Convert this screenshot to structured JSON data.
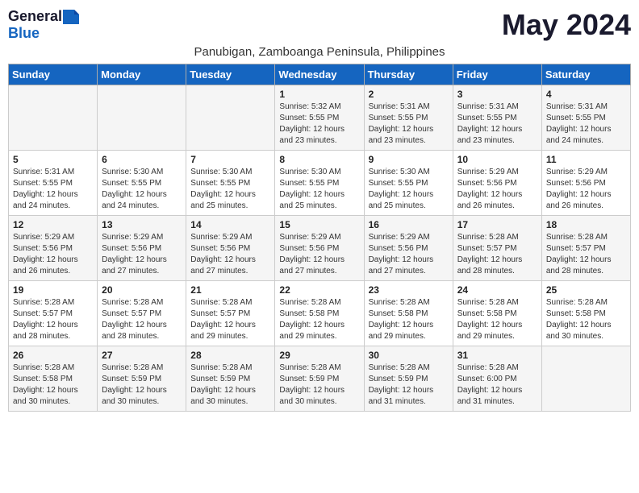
{
  "logo": {
    "general": "General",
    "blue": "Blue"
  },
  "header": {
    "month": "May 2024",
    "location": "Panubigan, Zamboanga Peninsula, Philippines"
  },
  "weekdays": [
    "Sunday",
    "Monday",
    "Tuesday",
    "Wednesday",
    "Thursday",
    "Friday",
    "Saturday"
  ],
  "weeks": [
    [
      {
        "day": "",
        "info": ""
      },
      {
        "day": "",
        "info": ""
      },
      {
        "day": "",
        "info": ""
      },
      {
        "day": "1",
        "info": "Sunrise: 5:32 AM\nSunset: 5:55 PM\nDaylight: 12 hours\nand 23 minutes."
      },
      {
        "day": "2",
        "info": "Sunrise: 5:31 AM\nSunset: 5:55 PM\nDaylight: 12 hours\nand 23 minutes."
      },
      {
        "day": "3",
        "info": "Sunrise: 5:31 AM\nSunset: 5:55 PM\nDaylight: 12 hours\nand 23 minutes."
      },
      {
        "day": "4",
        "info": "Sunrise: 5:31 AM\nSunset: 5:55 PM\nDaylight: 12 hours\nand 24 minutes."
      }
    ],
    [
      {
        "day": "5",
        "info": "Sunrise: 5:31 AM\nSunset: 5:55 PM\nDaylight: 12 hours\nand 24 minutes."
      },
      {
        "day": "6",
        "info": "Sunrise: 5:30 AM\nSunset: 5:55 PM\nDaylight: 12 hours\nand 24 minutes."
      },
      {
        "day": "7",
        "info": "Sunrise: 5:30 AM\nSunset: 5:55 PM\nDaylight: 12 hours\nand 25 minutes."
      },
      {
        "day": "8",
        "info": "Sunrise: 5:30 AM\nSunset: 5:55 PM\nDaylight: 12 hours\nand 25 minutes."
      },
      {
        "day": "9",
        "info": "Sunrise: 5:30 AM\nSunset: 5:55 PM\nDaylight: 12 hours\nand 25 minutes."
      },
      {
        "day": "10",
        "info": "Sunrise: 5:29 AM\nSunset: 5:56 PM\nDaylight: 12 hours\nand 26 minutes."
      },
      {
        "day": "11",
        "info": "Sunrise: 5:29 AM\nSunset: 5:56 PM\nDaylight: 12 hours\nand 26 minutes."
      }
    ],
    [
      {
        "day": "12",
        "info": "Sunrise: 5:29 AM\nSunset: 5:56 PM\nDaylight: 12 hours\nand 26 minutes."
      },
      {
        "day": "13",
        "info": "Sunrise: 5:29 AM\nSunset: 5:56 PM\nDaylight: 12 hours\nand 27 minutes."
      },
      {
        "day": "14",
        "info": "Sunrise: 5:29 AM\nSunset: 5:56 PM\nDaylight: 12 hours\nand 27 minutes."
      },
      {
        "day": "15",
        "info": "Sunrise: 5:29 AM\nSunset: 5:56 PM\nDaylight: 12 hours\nand 27 minutes."
      },
      {
        "day": "16",
        "info": "Sunrise: 5:29 AM\nSunset: 5:56 PM\nDaylight: 12 hours\nand 27 minutes."
      },
      {
        "day": "17",
        "info": "Sunrise: 5:28 AM\nSunset: 5:57 PM\nDaylight: 12 hours\nand 28 minutes."
      },
      {
        "day": "18",
        "info": "Sunrise: 5:28 AM\nSunset: 5:57 PM\nDaylight: 12 hours\nand 28 minutes."
      }
    ],
    [
      {
        "day": "19",
        "info": "Sunrise: 5:28 AM\nSunset: 5:57 PM\nDaylight: 12 hours\nand 28 minutes."
      },
      {
        "day": "20",
        "info": "Sunrise: 5:28 AM\nSunset: 5:57 PM\nDaylight: 12 hours\nand 28 minutes."
      },
      {
        "day": "21",
        "info": "Sunrise: 5:28 AM\nSunset: 5:57 PM\nDaylight: 12 hours\nand 29 minutes."
      },
      {
        "day": "22",
        "info": "Sunrise: 5:28 AM\nSunset: 5:58 PM\nDaylight: 12 hours\nand 29 minutes."
      },
      {
        "day": "23",
        "info": "Sunrise: 5:28 AM\nSunset: 5:58 PM\nDaylight: 12 hours\nand 29 minutes."
      },
      {
        "day": "24",
        "info": "Sunrise: 5:28 AM\nSunset: 5:58 PM\nDaylight: 12 hours\nand 29 minutes."
      },
      {
        "day": "25",
        "info": "Sunrise: 5:28 AM\nSunset: 5:58 PM\nDaylight: 12 hours\nand 30 minutes."
      }
    ],
    [
      {
        "day": "26",
        "info": "Sunrise: 5:28 AM\nSunset: 5:58 PM\nDaylight: 12 hours\nand 30 minutes."
      },
      {
        "day": "27",
        "info": "Sunrise: 5:28 AM\nSunset: 5:59 PM\nDaylight: 12 hours\nand 30 minutes."
      },
      {
        "day": "28",
        "info": "Sunrise: 5:28 AM\nSunset: 5:59 PM\nDaylight: 12 hours\nand 30 minutes."
      },
      {
        "day": "29",
        "info": "Sunrise: 5:28 AM\nSunset: 5:59 PM\nDaylight: 12 hours\nand 30 minutes."
      },
      {
        "day": "30",
        "info": "Sunrise: 5:28 AM\nSunset: 5:59 PM\nDaylight: 12 hours\nand 31 minutes."
      },
      {
        "day": "31",
        "info": "Sunrise: 5:28 AM\nSunset: 6:00 PM\nDaylight: 12 hours\nand 31 minutes."
      },
      {
        "day": "",
        "info": ""
      }
    ]
  ]
}
